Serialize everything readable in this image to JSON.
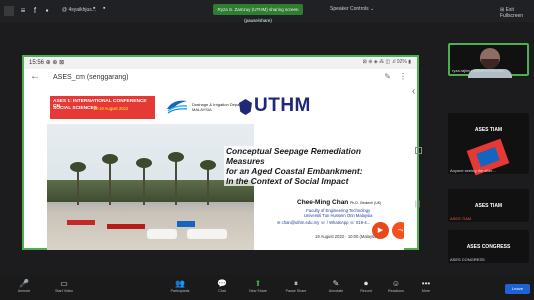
{
  "topbar": {
    "tab_title": "@ 4syaikhjus...",
    "share_banner": "Ryza S. Zamzuy (UTHM) sharing screen (pause/share)",
    "speaker_view": "Speaker Controls ⌄",
    "fullscreen": "⊞ Exit Fullscreen"
  },
  "phone": {
    "time": "15:56 ⊕ ⊕ ⊠",
    "system_icons": "⊠ ⊕ ◈ ⁂ ◫ .ıl 92% ▮",
    "app_title": "ASES_cm (senggarang)"
  },
  "slide": {
    "conf_line1": "ASES 1: INTERNATIONAL CONFERENCE ON",
    "conf_line2": "SOCIAL SCIENCES",
    "conf_dates": "18-19 August 2022",
    "dept_line1": "Drainage & Irrigation Department",
    "dept_line2": "MALAYSIA",
    "uthm": "UTHM",
    "title_line1": "Conceptual Seepage Remediation Measures",
    "title_line2": "for an Aged Coastal Embankment:",
    "title_line3": "In the Context of Social Impact",
    "author": "Chee-Ming Chan",
    "author_deg": "Ph.D. Geotech (UK)",
    "faculty_line1": "Faculty of Engineering Technology",
    "faculty_line2": "Universiti Tun Hussein Onn Malaysia",
    "contact": "✉ chan@uthm.edu.my ☏ / WhatsApp ☏ 019-4...",
    "date": "19 August 2022 · 10:00 (Malaysia)"
  },
  "participants": [
    {
      "name": "ryza.rajimunn@uthm.edu.my",
      "type": "video"
    },
    {
      "name": "ASES TIAM",
      "mark": "ASES TIAM",
      "type": "text"
    },
    {
      "name": "Anyone seeing the slide...",
      "type": "logo"
    },
    {
      "name": "ASES TIAM",
      "mark": "ASES TIAM",
      "type": "text"
    },
    {
      "name": "ASES CONGRESS",
      "mark": "ASES CONGRESS",
      "type": "text"
    }
  ],
  "toolbar": {
    "buttons": [
      {
        "icon": "🎤",
        "label": "Unmute"
      },
      {
        "icon": "▭",
        "label": "Start Video"
      },
      {
        "icon": "👥",
        "label": "Participants"
      },
      {
        "icon": "💬",
        "label": "Chat"
      },
      {
        "icon": "⬆",
        "label": "New Share"
      },
      {
        "icon": "⏸",
        "label": "Pause Share"
      },
      {
        "icon": "✎",
        "label": "Annotate"
      },
      {
        "icon": "⏺",
        "label": "Record"
      },
      {
        "icon": "☺",
        "label": "Reactions"
      },
      {
        "icon": "•••",
        "label": "More"
      }
    ],
    "leave": "Leave"
  },
  "colors": {
    "accent": "#4caf50",
    "uthm_navy": "#1e2a78",
    "conf_red": "#e53935",
    "leave_blue": "#1e63d6"
  }
}
